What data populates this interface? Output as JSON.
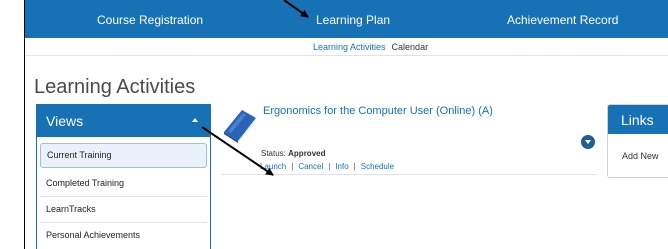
{
  "top_nav": {
    "items": [
      {
        "label": "Course Registration"
      },
      {
        "label": "Learning Plan"
      },
      {
        "label": "Achievement Record"
      }
    ]
  },
  "sub_nav": {
    "items": [
      {
        "label": "Learning Activities"
      },
      {
        "label": "Calendar"
      }
    ]
  },
  "page": {
    "title": "Learning Activities"
  },
  "views": {
    "title": "Views",
    "items": [
      {
        "label": "Current Training"
      },
      {
        "label": "Completed Training"
      },
      {
        "label": "LearnTracks"
      },
      {
        "label": "Personal Achievements"
      }
    ]
  },
  "course": {
    "title": "Ergonomics for the Computer User (Online) (A)",
    "status_label": "Status:",
    "status_value": "Approved",
    "actions": [
      {
        "label": "Launch"
      },
      {
        "label": "Cancel"
      },
      {
        "label": "Info"
      },
      {
        "label": "Schedule"
      }
    ]
  },
  "links": {
    "title": "Links",
    "item": "Add New"
  },
  "colors": {
    "primary": "#1672b5",
    "active_view_bg": "#e9f2fb",
    "annotation_arrow": "#000000"
  }
}
